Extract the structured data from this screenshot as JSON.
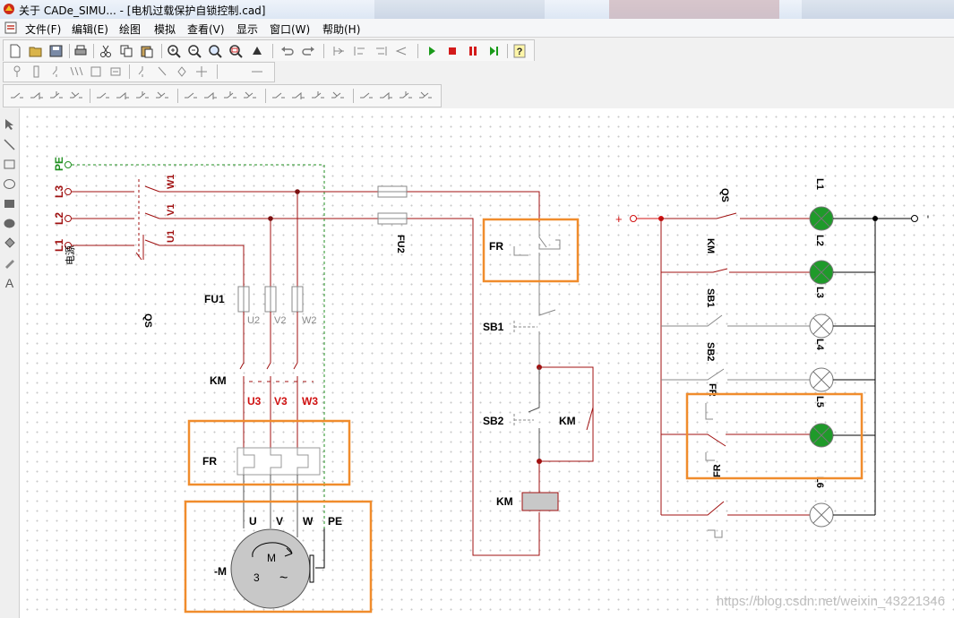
{
  "window": {
    "title": "关于 CADe_SIMU... - [电机过载保护自锁控制.cad]",
    "menu": [
      "文件(F)",
      "编辑(E)",
      "绘图",
      "模拟",
      "查看(V)",
      "显示",
      "窗口(W)",
      "帮助(H)"
    ]
  },
  "toolbar": {
    "file_tools": [
      "new-icon",
      "open-icon",
      "save-icon",
      "print-icon",
      "cut-icon",
      "copy-icon",
      "paste-icon"
    ],
    "zoom_tools": [
      "zoom-in-icon",
      "zoom-out-icon",
      "zoom-fit-icon",
      "zoom-window-icon",
      "pan-icon"
    ],
    "sim_tools": [
      "play-icon",
      "stop-icon",
      "pause-icon",
      "step-icon"
    ],
    "colors": {
      "play": "#1a9a1a",
      "stop": "#d31a1a",
      "pause": "#d31a1a",
      "step": "#1a9a1a"
    }
  },
  "power_circuit": {
    "lines": {
      "pe": "PE",
      "l3": "L3",
      "l2": "L2",
      "l1": "L1"
    },
    "source_label": "电源",
    "switch": {
      "name": "QS",
      "contacts": [
        "W1",
        "V1",
        "U1"
      ]
    },
    "fuse": {
      "name": "FU1",
      "outs": [
        "U2",
        "V2",
        "W2"
      ]
    },
    "contactor": {
      "name": "KM",
      "outs": [
        "U3",
        "V3",
        "W3"
      ]
    },
    "overload": {
      "name": "FR"
    },
    "motor": {
      "name": "-M",
      "terms": [
        "U",
        "V",
        "W",
        "PE"
      ],
      "symbol_m": "M",
      "phases": "3",
      "wave": "~"
    }
  },
  "control_circuit": {
    "fuse": "FU2",
    "fr_contact": "FR",
    "stop_button": "SB1",
    "start_button": "SB2",
    "hold_contact": "KM",
    "coil": "KM"
  },
  "indicator_circuit": {
    "plus": "+",
    "minus": "-",
    "branches": [
      {
        "contact": "QS",
        "lamp": "L1",
        "lit": true
      },
      {
        "contact": "KM",
        "lamp": "L2",
        "lit": true
      },
      {
        "contact": "SB1",
        "lamp": "L3",
        "lit": false
      },
      {
        "contact": "SB2",
        "lamp": "L4",
        "lit": false
      },
      {
        "contact": "FR",
        "lamp": "L5",
        "lit": true
      },
      {
        "contact": "FR",
        "lamp": "L6",
        "lit": false
      }
    ]
  },
  "watermark": "https://blog.csdn.net/weixin_43221346",
  "colors": {
    "live_wire": "#a01010",
    "idle_wire": "#888888",
    "pe_wire": "#1f8f1f",
    "highlight": "#f08c2c",
    "lamp_on": "#1f9a2a"
  }
}
